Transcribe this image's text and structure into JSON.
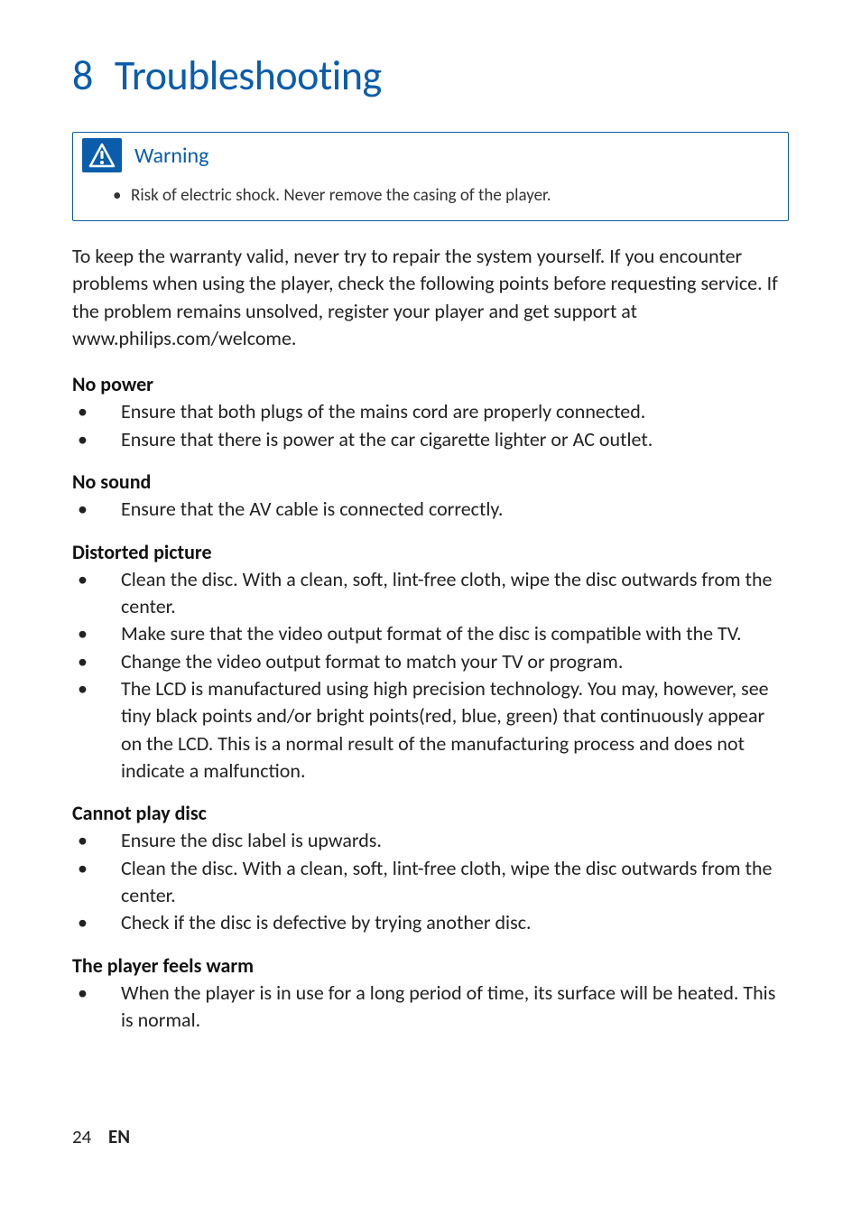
{
  "chapter": {
    "number": "8",
    "title": "Troubleshooting"
  },
  "warning": {
    "label": "Warning",
    "items": [
      "Risk of electric shock. Never remove the casing of the player."
    ]
  },
  "intro": "To keep the warranty valid, never try to repair the system yourself.\nIf you encounter problems when using the player, check the following points before requesting service. If the problem remains unsolved, register your player and get support at www.philips.com/welcome.",
  "sections": [
    {
      "heading": "No power",
      "items": [
        "Ensure that both plugs of the mains cord are properly connected.",
        "Ensure that there is power at the car cigarette lighter or AC outlet."
      ]
    },
    {
      "heading": "No sound",
      "items": [
        "Ensure that the AV cable is connected correctly."
      ]
    },
    {
      "heading": "Distorted picture",
      "items": [
        "Clean the disc. With a clean, soft, lint-free cloth, wipe the disc outwards from the center.",
        "Make sure that the video output format of the disc is compatible with the TV.",
        "Change the video output format to match your TV or program.",
        "The LCD is manufactured using high precision technology. You may, however, see tiny black points and/or bright points(red, blue, green) that continuously appear on the LCD. This is a normal result of the manufacturing process and does not indicate a malfunction."
      ]
    },
    {
      "heading": "Cannot play disc",
      "items": [
        "Ensure the disc label is upwards.",
        "Clean the disc. With a clean, soft, lint-free cloth, wipe the disc outwards from the center.",
        "Check if the disc is defective by trying another disc."
      ]
    },
    {
      "heading": "The player feels warm",
      "items": [
        "When the player is in use for a long period of time, its surface will be heated. This is normal."
      ]
    }
  ],
  "footer": {
    "page": "24",
    "lang": "EN"
  }
}
